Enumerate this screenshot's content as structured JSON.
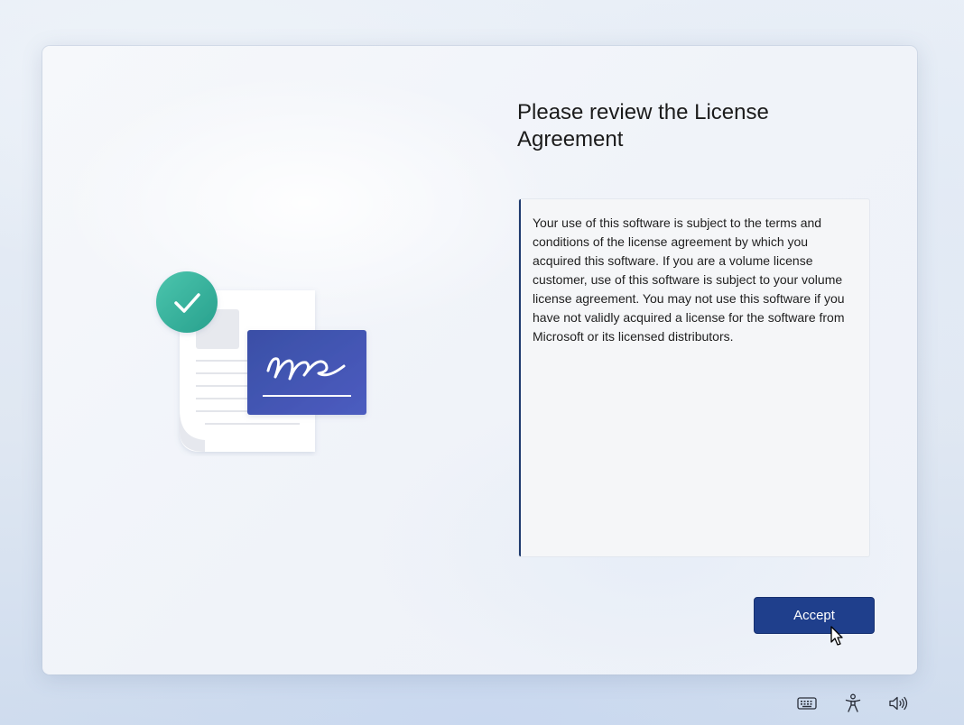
{
  "dialog": {
    "title": "Please review the License Agreement",
    "license_text": "Your use of this software is subject to the terms and conditions of the license agreement by which you acquired this software. If you are a volume license customer, use of this software is subject to your volume license agreement. You may not use this software if you have not validly acquired a license for the software from Microsoft or its licensed distributors.",
    "accept_label": "Accept"
  },
  "illustration": {
    "icons": [
      "document-icon",
      "check-badge-icon",
      "signature-card-icon"
    ]
  },
  "taskbar": {
    "icons": [
      "keyboard-icon",
      "accessibility-icon",
      "volume-icon"
    ]
  },
  "colors": {
    "accent": "#1f3f8c",
    "check_badge": "#3cb49f",
    "signature_card": "#3f51a6"
  }
}
